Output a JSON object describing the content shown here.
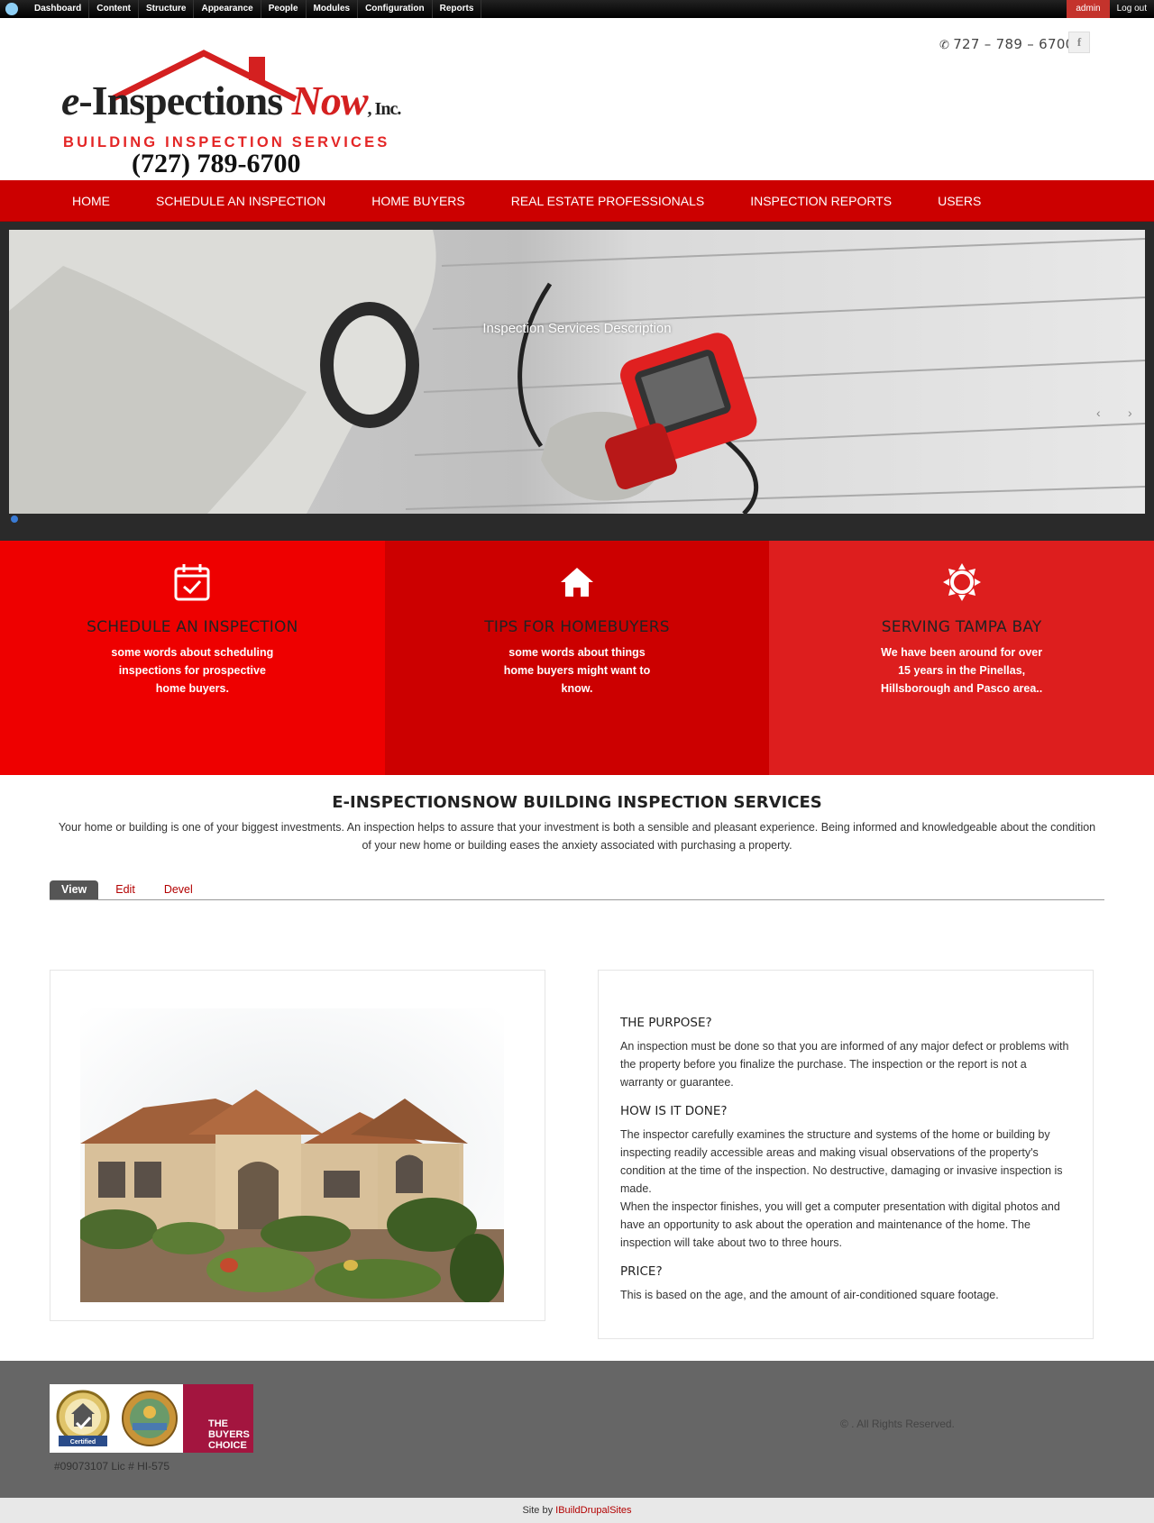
{
  "admin": {
    "items": [
      "Dashboard",
      "Content",
      "Structure",
      "Appearance",
      "People",
      "Modules",
      "Configuration",
      "Reports"
    ],
    "user": "admin",
    "logout": "Log out"
  },
  "header": {
    "phone": "727 – 789 – 6700",
    "facebook_glyph": "f",
    "logo": {
      "word_e": "e",
      "word_inspections": "-Inspections ",
      "word_now": "Now",
      "word_inc": ", Inc.",
      "tagline": "BUILDING INSPECTION SERVICES",
      "phone": "(727) 789-6700"
    }
  },
  "nav": [
    "HOME",
    "SCHEDULE AN INSPECTION",
    "HOME BUYERS",
    "REAL ESTATE PROFESSIONALS",
    "INSPECTION REPORTS",
    "USERS"
  ],
  "slider": {
    "caption": "Inspection Services Description",
    "prev": "‹",
    "next": "›"
  },
  "features": [
    {
      "icon": "calendar-check-icon",
      "title": "SCHEDULE AN INSPECTION",
      "text": "some words about scheduling inspections for prospective home buyers."
    },
    {
      "icon": "home-icon",
      "title": "TIPS FOR HOMEBUYERS",
      "text": "some words about things home buyers might want to know."
    },
    {
      "icon": "sun-icon",
      "title": "SERVING TAMPA BAY",
      "text": "We have been around for over 15 years in the Pinellas, Hillsborough and Pasco area.."
    }
  ],
  "intro": {
    "title": "E-INSPECTIONSNOW BUILDING INSPECTION SERVICES",
    "text": "Your home or building is one of your biggest investments.  An inspection helps to assure that your investment is both a sensible and pleasant experience.  Being informed and knowledgeable about the condition of your new home or building eases the anxiety associated with purchasing a property."
  },
  "tabs": [
    "View",
    "Edit",
    "Devel"
  ],
  "sections": [
    {
      "title": "THE PURPOSE?",
      "text": "An inspection must be done so that you are informed of any major defect or problems with the property before you finalize the purchase. The inspection or the report is not a warranty or guarantee."
    },
    {
      "title": "HOW IS IT DONE?",
      "text": "The inspector carefully examines the structure and systems of the home or building by inspecting readily accessible areas and making visual observations of the property's condition at the time of the inspection. No destructive, damaging or invasive inspection is made.",
      "text2": "When the inspector finishes, you will get a computer presentation with digital photos and have an opportunity to ask about the operation and maintenance of the home. The inspection will take about two to three hours."
    },
    {
      "title": "PRICE?",
      "text": "This is based on the age, and the amount of air-conditioned square footage."
    }
  ],
  "footer": {
    "badge_text": "THE BUYERS CHOICE",
    "badge_a_label": "Certified",
    "license": "#09073107  Lic # HI-575",
    "copyright": "© . All Rights Reserved.",
    "site_by_prefix": "Site by ",
    "site_by_link": "IBuildDrupalSites"
  },
  "colors": {
    "brand_red": "#cc0000",
    "feature1": "#ee0000",
    "feature2": "#cc0000",
    "feature3": "#dd1e1e",
    "footer": "#666666"
  }
}
